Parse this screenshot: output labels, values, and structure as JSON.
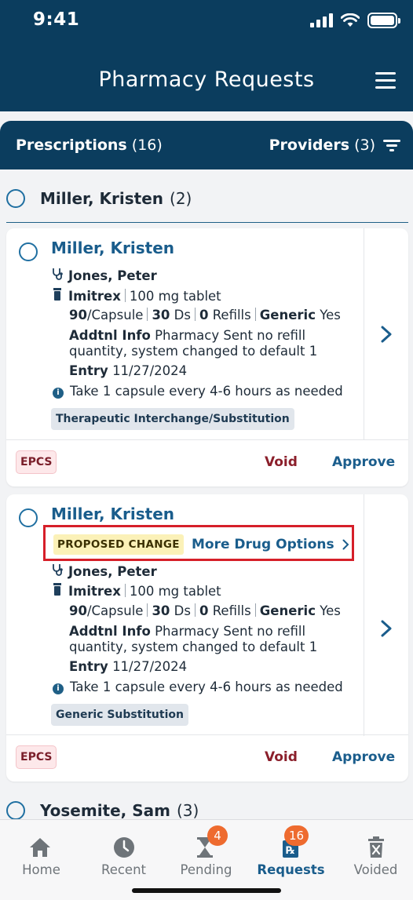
{
  "status_bar": {
    "time": "9:41"
  },
  "header": {
    "title": "Pharmacy Requests"
  },
  "subbar": {
    "prescriptions_label": "Prescriptions",
    "prescriptions_count": "(16)",
    "providers_label": "Providers",
    "providers_count": "(3)"
  },
  "groups": [
    {
      "name": "Miller, Kristen",
      "count": "(2)"
    },
    {
      "name": "Yosemite, Sam",
      "count": "(3)"
    }
  ],
  "cards": [
    {
      "patient": "Miller, Kristen",
      "provider": "Jones, Peter",
      "drug_name": "Imitrex",
      "drug_strength": "100 mg tablet",
      "qty": "90",
      "qty_unit": "/Capsule",
      "days": "30",
      "days_unit": "Ds",
      "refills": "0",
      "refills_unit": "Refills",
      "generic_label": "Generic",
      "generic_value": "Yes",
      "addtnl_label": "Addtnl Info",
      "addtnl_line1": "Pharmacy Sent no refill",
      "addtnl_line2": "quantity, system changed to default 1",
      "entry_label": "Entry",
      "entry_date": "11/27/2024",
      "sig": "Take 1 capsule every 4-6 hours as needed",
      "tag": "Therapeutic Interchange/Substitution",
      "epcs": "EPCS",
      "void": "Void",
      "approve": "Approve"
    },
    {
      "patient": "Miller, Kristen",
      "proposed": "PROPOSED CHANGE",
      "more_options": "More Drug Options",
      "provider": "Jones, Peter",
      "drug_name": "Imitrex",
      "drug_strength": "100 mg tablet",
      "qty": "90",
      "qty_unit": "/Capsule",
      "days": "30",
      "days_unit": "Ds",
      "refills": "0",
      "refills_unit": "Refills",
      "generic_label": "Generic",
      "generic_value": "Yes",
      "addtnl_label": "Addtnl Info",
      "addtnl_line1": "Pharmacy Sent no refill",
      "addtnl_line2": "quantity, system changed to default 1",
      "entry_label": "Entry",
      "entry_date": "11/27/2024",
      "sig": "Take 1 capsule every 4-6 hours as needed",
      "tag": "Generic Substitution",
      "epcs": "EPCS",
      "void": "Void",
      "approve": "Approve"
    }
  ],
  "tabbar": {
    "home": "Home",
    "recent": "Recent",
    "pending": "Pending",
    "pending_badge": "4",
    "requests": "Requests",
    "requests_badge": "16",
    "voided": "Voided"
  },
  "colors": {
    "primary": "#0b3d5e",
    "link": "#1a5d8c",
    "void": "#8b1f2b",
    "badge": "#ee6b2f",
    "highlight_border": "#d61f29"
  },
  "icons": [
    "signal-icon",
    "wifi-icon",
    "battery-icon",
    "menu-icon",
    "filter-icon",
    "stethoscope-icon",
    "pill-bottle-icon",
    "info-icon",
    "chevron-right-icon",
    "home-icon",
    "clock-icon",
    "hourglass-icon",
    "rx-icon",
    "trash-icon"
  ]
}
